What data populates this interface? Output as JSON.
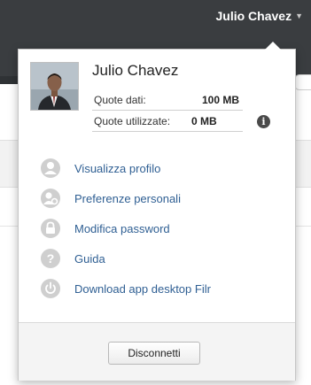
{
  "header": {
    "user_name": "Julio Chavez",
    "chevron_icon": "chevron-down-icon"
  },
  "profile": {
    "name": "Julio Chavez",
    "quota_label": "Quote dati:",
    "quota_value": "100 MB",
    "used_label": "Quote utilizzate:",
    "used_value": "0 MB",
    "info_icon": "info-icon"
  },
  "menu": {
    "items": [
      {
        "label": "Visualizza profilo",
        "icon": "user-icon"
      },
      {
        "label": "Preferenze personali",
        "icon": "user-settings-icon"
      },
      {
        "label": "Modifica password",
        "icon": "lock-icon"
      },
      {
        "label": "Guida",
        "icon": "help-icon"
      },
      {
        "label": "Download app desktop Filr",
        "icon": "power-icon"
      }
    ]
  },
  "footer": {
    "logout_label": "Disconnetti"
  },
  "colors": {
    "header_bg": "#3a3d40",
    "link": "#2f5f93",
    "icon_gray": "#cfcfcf"
  }
}
